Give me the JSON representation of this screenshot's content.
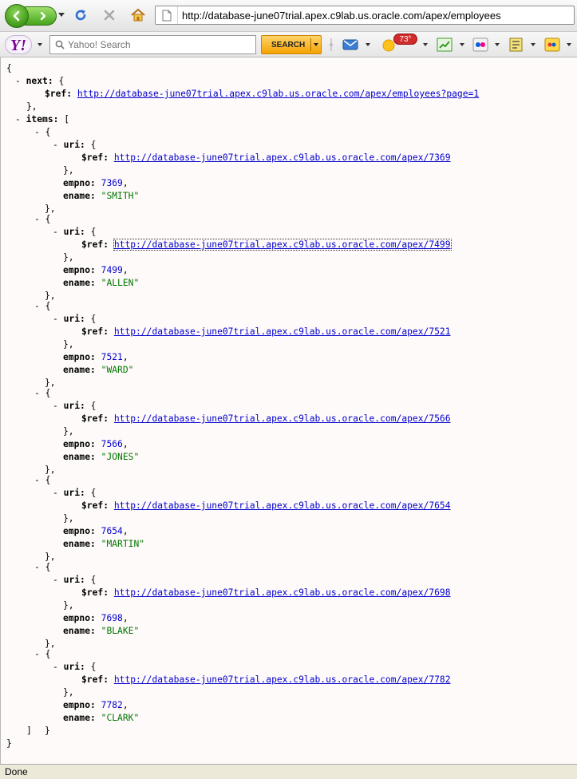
{
  "browser": {
    "url": "http://database-june07trial.apex.c9lab.us.oracle.com/apex/employees",
    "status": "Done"
  },
  "yahoo_toolbar": {
    "search_placeholder": "Yahoo! Search",
    "search_button": "SEARCH",
    "weather_temp": "73°"
  },
  "json_view": {
    "next_key": "next",
    "items_key": "items",
    "ref_key": "$ref",
    "uri_key": "uri",
    "empno_key": "empno",
    "ename_key": "ename",
    "next_ref": "http://database-june07trial.apex.c9lab.us.oracle.com/apex/employees?page=1",
    "items": [
      {
        "ref": "http://database-june07trial.apex.c9lab.us.oracle.com/apex/7369",
        "empno": "7369",
        "ename": "\"SMITH\""
      },
      {
        "ref": "http://database-june07trial.apex.c9lab.us.oracle.com/apex/7499",
        "empno": "7499",
        "ename": "\"ALLEN\""
      },
      {
        "ref": "http://database-june07trial.apex.c9lab.us.oracle.com/apex/7521",
        "empno": "7521",
        "ename": "\"WARD\""
      },
      {
        "ref": "http://database-june07trial.apex.c9lab.us.oracle.com/apex/7566",
        "empno": "7566",
        "ename": "\"JONES\""
      },
      {
        "ref": "http://database-june07trial.apex.c9lab.us.oracle.com/apex/7654",
        "empno": "7654",
        "ename": "\"MARTIN\""
      },
      {
        "ref": "http://database-june07trial.apex.c9lab.us.oracle.com/apex/7698",
        "empno": "7698",
        "ename": "\"BLAKE\""
      },
      {
        "ref": "http://database-june07trial.apex.c9lab.us.oracle.com/apex/7782",
        "empno": "7782",
        "ename": "\"CLARK\""
      }
    ]
  },
  "colors": {
    "link": "#0000cc",
    "number": "#0000cc",
    "string": "#007700",
    "content_bg": "#fffafa"
  }
}
